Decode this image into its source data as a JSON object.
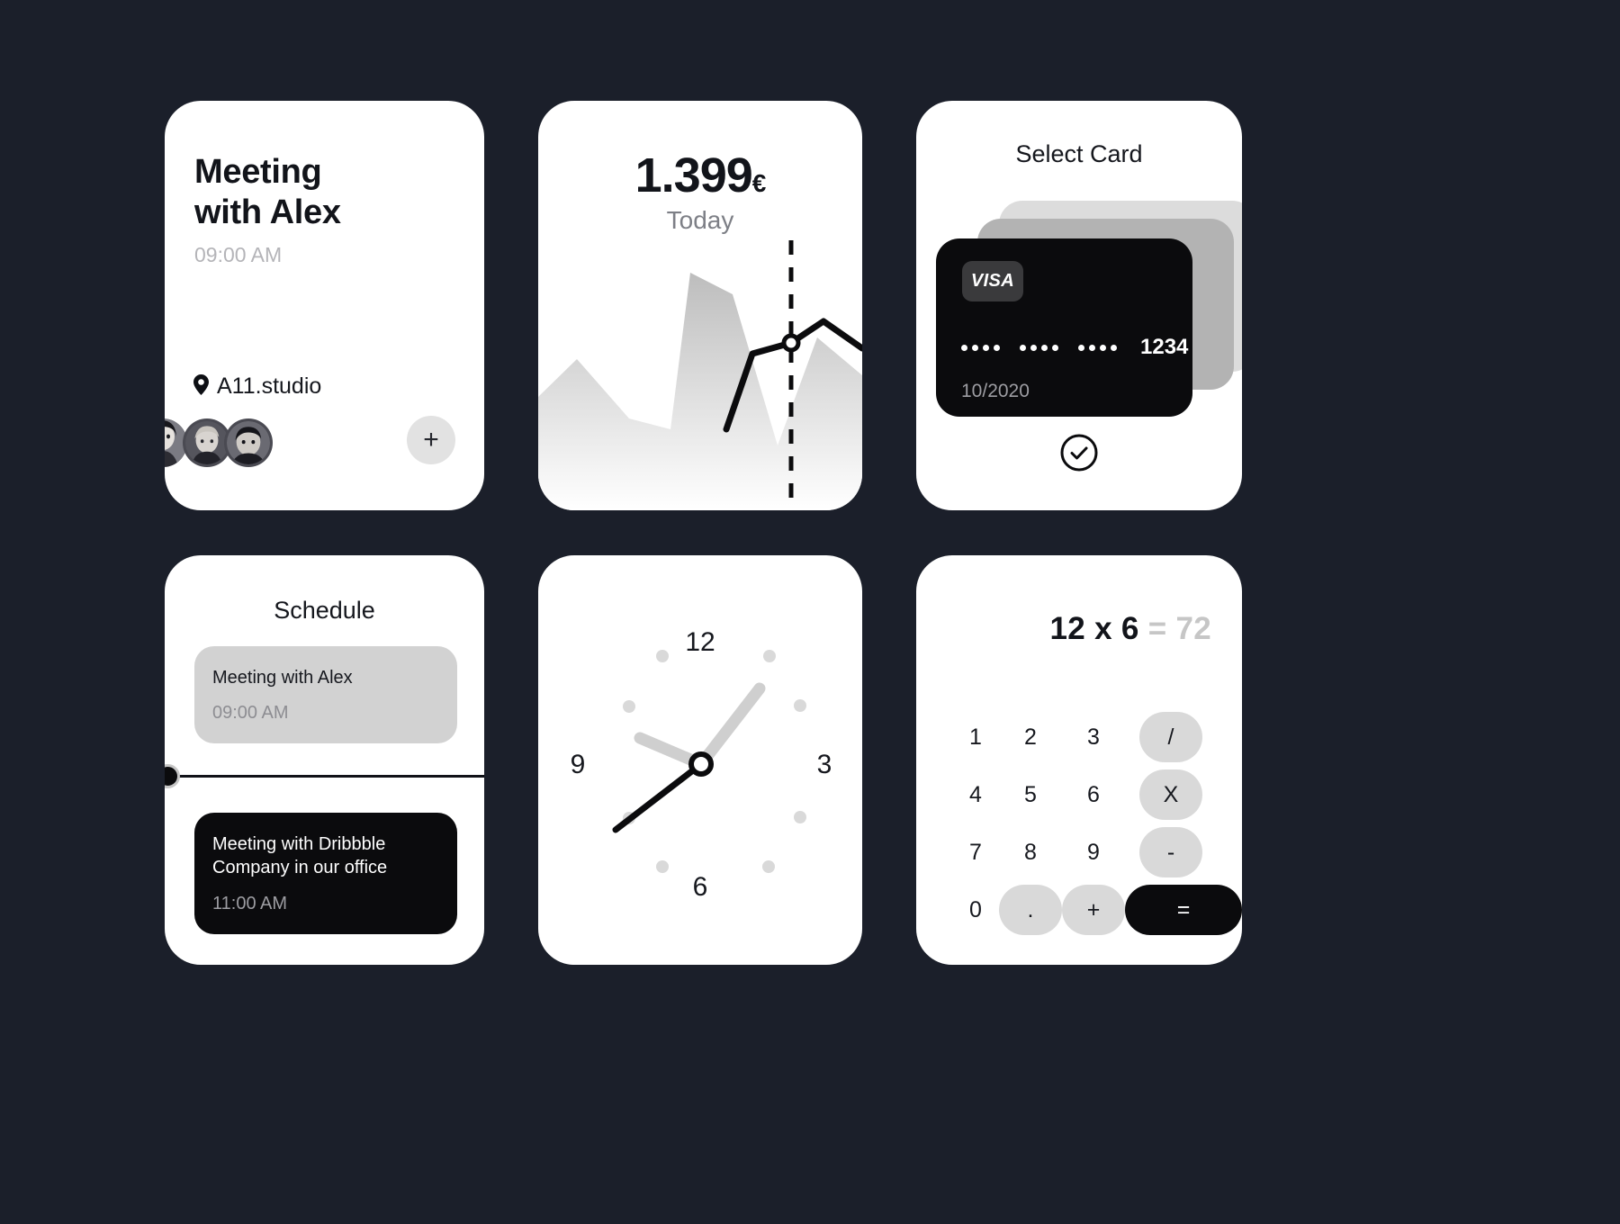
{
  "theme": {
    "page_background": "#1b1f2a",
    "card_background": "#ffffff",
    "accent_dark": "#0b0b0d",
    "muted_text": "#b4b4b8"
  },
  "meeting_card": {
    "title": "Meeting\nwith Alex",
    "time": "09:00 AM",
    "location": "A11.studio",
    "location_icon": "map-pin-icon",
    "add_label": "+",
    "attendees": [
      "attendee-1",
      "attendee-2",
      "attendee-3"
    ]
  },
  "balance_card": {
    "amount": "1.399",
    "currency": "€",
    "period": "Today",
    "chart_data": {
      "type": "area",
      "title": "1.399€ Today",
      "xlabel": "",
      "ylabel": "",
      "grid": false,
      "legend": null,
      "marker_x": 0.78,
      "marker_y": 0.62,
      "series": [
        {
          "name": "background-area",
          "style": "area-gray-gradient",
          "x": [
            0.0,
            0.12,
            0.28,
            0.41,
            0.47,
            0.6,
            0.74,
            0.86,
            1.0
          ],
          "values": [
            0.42,
            0.56,
            0.34,
            0.3,
            0.88,
            0.8,
            0.24,
            0.6,
            0.5
          ]
        },
        {
          "name": "foreground-line",
          "style": "line-black",
          "x": [
            0.58,
            0.66,
            0.78,
            0.88,
            1.0
          ],
          "values": [
            0.3,
            0.58,
            0.62,
            0.72,
            0.6
          ]
        }
      ]
    }
  },
  "select_card": {
    "title": "Select Card",
    "brand": "VISA",
    "masked_groups": [
      "••••",
      "••••",
      "••••"
    ],
    "last4": "1234",
    "expiry": "10/2020",
    "confirm_icon": "check-circle-icon",
    "stack_count": 3
  },
  "schedule_card": {
    "title": "Schedule",
    "items": [
      {
        "title": "Meeting with Alex",
        "time": "09:00 AM",
        "state": "past"
      },
      {
        "title": "Meeting with Dribbble\nCompany in our office",
        "time": "11:00 AM",
        "state": "active"
      }
    ],
    "now_marker": "current-time-marker"
  },
  "clock_card": {
    "numerals": [
      "12",
      "3",
      "6",
      "9"
    ],
    "hour_hand_deg": 55,
    "minute_hand_deg": 248,
    "second_hand_deg": 215,
    "tick_count": 8
  },
  "calculator_card": {
    "expression": "12 x 6",
    "equals_sign": "=",
    "result": "72",
    "keys": [
      {
        "label": "1",
        "type": "num"
      },
      {
        "label": "2",
        "type": "num"
      },
      {
        "label": "3",
        "type": "num"
      },
      {
        "label": "/",
        "type": "op"
      },
      {
        "label": "4",
        "type": "num"
      },
      {
        "label": "5",
        "type": "num"
      },
      {
        "label": "6",
        "type": "num"
      },
      {
        "label": "X",
        "type": "op"
      },
      {
        "label": "7",
        "type": "num"
      },
      {
        "label": "8",
        "type": "num"
      },
      {
        "label": "9",
        "type": "num"
      },
      {
        "label": "-",
        "type": "op"
      },
      {
        "label": "0",
        "type": "num"
      },
      {
        "label": ".",
        "type": "op"
      },
      {
        "label": "+",
        "type": "op"
      },
      {
        "label": "=",
        "type": "eq"
      }
    ]
  }
}
